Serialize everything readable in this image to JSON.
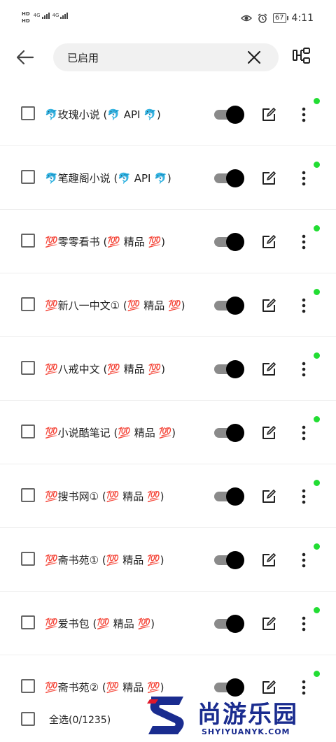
{
  "status_bar": {
    "hd1": "HD",
    "hd2": "HD",
    "net1": "4G",
    "net2": "4G",
    "battery": "67",
    "time": "4:11"
  },
  "toolbar": {
    "search_text": "已启用"
  },
  "sources": [
    {
      "label": "🐬玫瑰小说 (🐬 API 🐬)"
    },
    {
      "label": "🐬笔趣阁小说 (🐬 API 🐬)"
    },
    {
      "label": "💯零零看书 (💯 精品 💯)"
    },
    {
      "label": "💯新八一中文① (💯 精品 💯)"
    },
    {
      "label": "💯八戒中文 (💯 精品 💯)"
    },
    {
      "label": "💯小说酷笔记 (💯 精品 💯)"
    },
    {
      "label": "💯搜书网① (💯 精品 💯)"
    },
    {
      "label": "💯斋书苑① (💯 精品 💯)"
    },
    {
      "label": "💯爱书包 (💯 精品 💯)"
    },
    {
      "label": "💯斋书苑② (💯 精品 💯)"
    }
  ],
  "bottom_bar": {
    "select_all": "全选(0/1235)"
  },
  "watermark": {
    "title": "尚游乐园",
    "subtitle": "SHYIYUANYK.COM"
  },
  "colors": {
    "status_dot": "#22dd33",
    "toggle_thumb": "#000000",
    "toggle_track": "#8a8a8a",
    "watermark": "#1a2c8f"
  }
}
